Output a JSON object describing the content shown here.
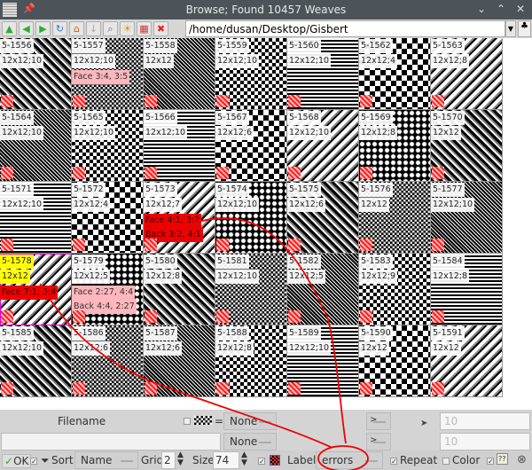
{
  "window": {
    "title": "Browse; Found 10457 Weaves"
  },
  "toolbar": {
    "buttons": [
      "up-icon",
      "back-icon",
      "forward-icon",
      "refresh-icon",
      "home-icon",
      "sort-icon",
      "preview-icon",
      "image-icon",
      "palette-icon",
      "delete-icon"
    ],
    "path": "/home/dusan/Desktop/Gisbert"
  },
  "cells": [
    {
      "id": "5-1556",
      "size": "12x12;10"
    },
    {
      "id": "5-1557",
      "size": "12x12;10",
      "face": "Face 3:4, 3:5"
    },
    {
      "id": "5-1558",
      "size": "12x12"
    },
    {
      "id": "5-1559",
      "size": "12x12;10"
    },
    {
      "id": "5-1560",
      "size": "12x12;10"
    },
    {
      "id": "5-1562",
      "size": "12x12;4"
    },
    {
      "id": "5-1563",
      "size": "12x12;8"
    },
    {
      "id": "5-1564",
      "size": "12x12;10"
    },
    {
      "id": "5-1565",
      "size": "12x12;10"
    },
    {
      "id": "5-1566",
      "size": "12x12;10"
    },
    {
      "id": "5-1567",
      "size": "12x12;6"
    },
    {
      "id": "5-1568",
      "size": "12x12;10"
    },
    {
      "id": "5-1569",
      "size": "12x12;8"
    },
    {
      "id": "5-1570",
      "size": "12x12"
    },
    {
      "id": "5-1571",
      "size": "12x12;10"
    },
    {
      "id": "5-1572",
      "size": "12x12;4"
    },
    {
      "id": "5-1573",
      "size": "12x12;7",
      "face": "Face 4:1, 3:2",
      "back": "Back 3:2, 4:1",
      "error": true
    },
    {
      "id": "5-1574",
      "size": "12x12;10"
    },
    {
      "id": "5-1575",
      "size": "12x12;6"
    },
    {
      "id": "5-1576",
      "size": "12x12"
    },
    {
      "id": "5-1577",
      "size": "12x12;10"
    },
    {
      "id": "5-1578",
      "size": "12x12",
      "face": "Face 7:1, 5:4",
      "error": true,
      "selected": true
    },
    {
      "id": "5-1579",
      "size": "12x12;5",
      "face": "Face 2:27, 4:4",
      "back": "Back 4:4, 2:27"
    },
    {
      "id": "5-1580",
      "size": "12x12;8"
    },
    {
      "id": "5-1581",
      "size": "12x12;10"
    },
    {
      "id": "5-1582",
      "size": "12x12;5"
    },
    {
      "id": "5-1583",
      "size": "12x12;9"
    },
    {
      "id": "5-1584",
      "size": "12x12;8"
    },
    {
      "id": "5-1585",
      "size": "12x12;10"
    },
    {
      "id": "5-1586",
      "size": "12x12;6"
    },
    {
      "id": "5-1587",
      "size": "12x12;6"
    },
    {
      "id": "5-1588",
      "size": "12x12;8"
    },
    {
      "id": "5-1589",
      "size": "12x12;10"
    },
    {
      "id": "5-1590",
      "size": "12x12"
    },
    {
      "id": "5-1591",
      "size": "12x12"
    }
  ],
  "filter": {
    "filename_label": "Filename",
    "equals": "=",
    "select1": "None",
    "select2": "None",
    "op1": ">",
    "op2": ">",
    "value1": "10",
    "value2": "10",
    "filename_value": ""
  },
  "bottom": {
    "ok": "OK",
    "sort": "Sort",
    "sort_by": "Name",
    "grid_label": "Grid",
    "grid_value": "2",
    "size_label": "Size",
    "size_value": "74",
    "label_label": "Label",
    "label_value": "errors",
    "repeat": "Repeat",
    "color": "Color",
    "help": "??"
  },
  "colors": {
    "annotation": "#e00000",
    "selection": "#d000d0"
  }
}
